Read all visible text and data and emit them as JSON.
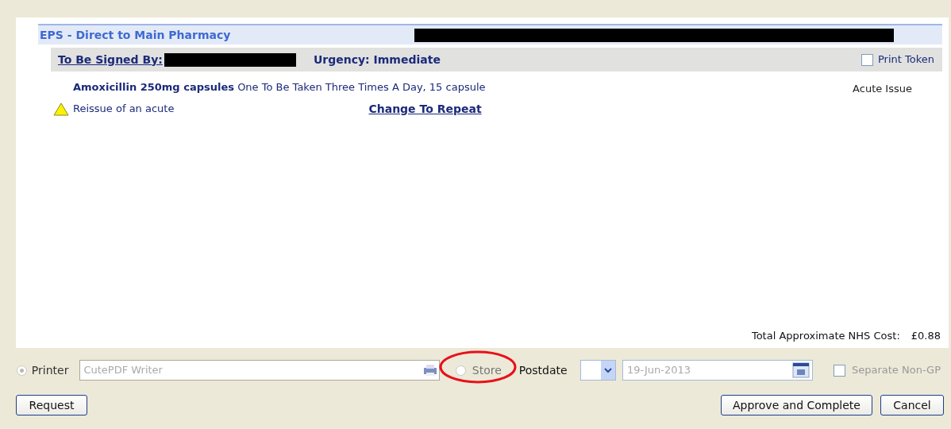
{
  "header": {
    "title": "EPS - Direct to Main Pharmacy"
  },
  "signing": {
    "label": "To Be Signed By:",
    "urgency": "Urgency: Immediate",
    "print_token": {
      "label": "Print Token",
      "checked": false
    }
  },
  "items": [
    {
      "drug": "Amoxicillin 250mg capsules",
      "dosage": "One To Be Taken Three Times A Day, 15 capsule",
      "issue_type": "Acute Issue",
      "warning": "Reissue of an acute",
      "action": "Change To Repeat"
    }
  ],
  "total": {
    "label": "Total Approximate NHS Cost:",
    "value": "£0.88"
  },
  "output": {
    "options": [
      {
        "label": "Printer",
        "selected": true
      },
      {
        "label": "Store",
        "selected": false
      }
    ],
    "printer": {
      "value": "CutePDF Writer"
    },
    "postdate": {
      "label": "Postdate",
      "date": "19-Jun-2013"
    },
    "separate": {
      "label": "Separate Non-GP",
      "checked": false
    }
  },
  "buttons": {
    "left": [
      "Request"
    ],
    "right": [
      "Approve and Complete",
      "Cancel"
    ]
  }
}
